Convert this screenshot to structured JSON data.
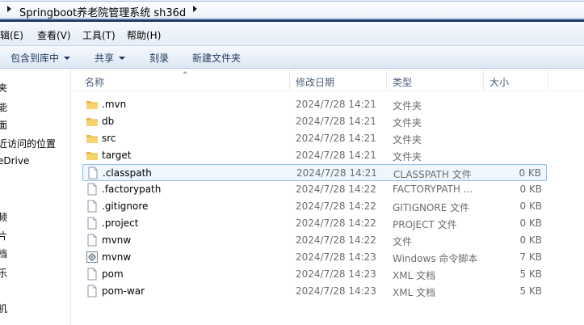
{
  "address_bar": {
    "path": "Springboot养老院管理系统 sh36d"
  },
  "menu": [
    {
      "label": "编辑(E)"
    },
    {
      "label": "查看(V)"
    },
    {
      "label": "工具(T)"
    },
    {
      "label": "帮助(H)"
    }
  ],
  "toolbar": {
    "include_library": "包含到库中",
    "share": "共享",
    "burn": "刻录",
    "new_folder": "新建文件夹"
  },
  "nav_pane": [
    "夹",
    "能",
    "面",
    "近访问的位置",
    "eDrive",
    "频",
    "片",
    "档",
    "乐",
    "机"
  ],
  "columns": {
    "name": "名称",
    "modified": "修改日期",
    "type": "类型",
    "size": "大小"
  },
  "files": [
    {
      "name": ".mvn",
      "modified": "2024/7/28 14:21",
      "type": "文件夹",
      "size": "",
      "icon": "folder-icon"
    },
    {
      "name": "db",
      "modified": "2024/7/28 14:21",
      "type": "文件夹",
      "size": "",
      "icon": "folder-icon"
    },
    {
      "name": "src",
      "modified": "2024/7/28 14:21",
      "type": "文件夹",
      "size": "",
      "icon": "folder-icon"
    },
    {
      "name": "target",
      "modified": "2024/7/28 14:21",
      "type": "文件夹",
      "size": "",
      "icon": "folder-icon"
    },
    {
      "name": ".classpath",
      "modified": "2024/7/28 14:21",
      "type": "CLASSPATH 文件",
      "size": "0 KB",
      "icon": "file-icon",
      "selected": true
    },
    {
      "name": ".factorypath",
      "modified": "2024/7/28 14:22",
      "type": "FACTORYPATH ...",
      "size": "0 KB",
      "icon": "file-icon"
    },
    {
      "name": ".gitignore",
      "modified": "2024/7/28 14:22",
      "type": "GITIGNORE 文件",
      "size": "0 KB",
      "icon": "file-icon"
    },
    {
      "name": ".project",
      "modified": "2024/7/28 14:22",
      "type": "PROJECT 文件",
      "size": "0 KB",
      "icon": "file-icon"
    },
    {
      "name": "mvnw",
      "modified": "2024/7/28 14:22",
      "type": "文件",
      "size": "0 KB",
      "icon": "file-icon"
    },
    {
      "name": "mvnw",
      "modified": "2024/7/28 14:23",
      "type": "Windows 命令脚本",
      "size": "7 KB",
      "icon": "script-icon"
    },
    {
      "name": "pom",
      "modified": "2024/7/28 14:23",
      "type": "XML 文档",
      "size": "5 KB",
      "icon": "file-icon"
    },
    {
      "name": "pom-war",
      "modified": "2024/7/28 14:23",
      "type": "XML 文档",
      "size": "5 KB",
      "icon": "file-icon"
    }
  ]
}
